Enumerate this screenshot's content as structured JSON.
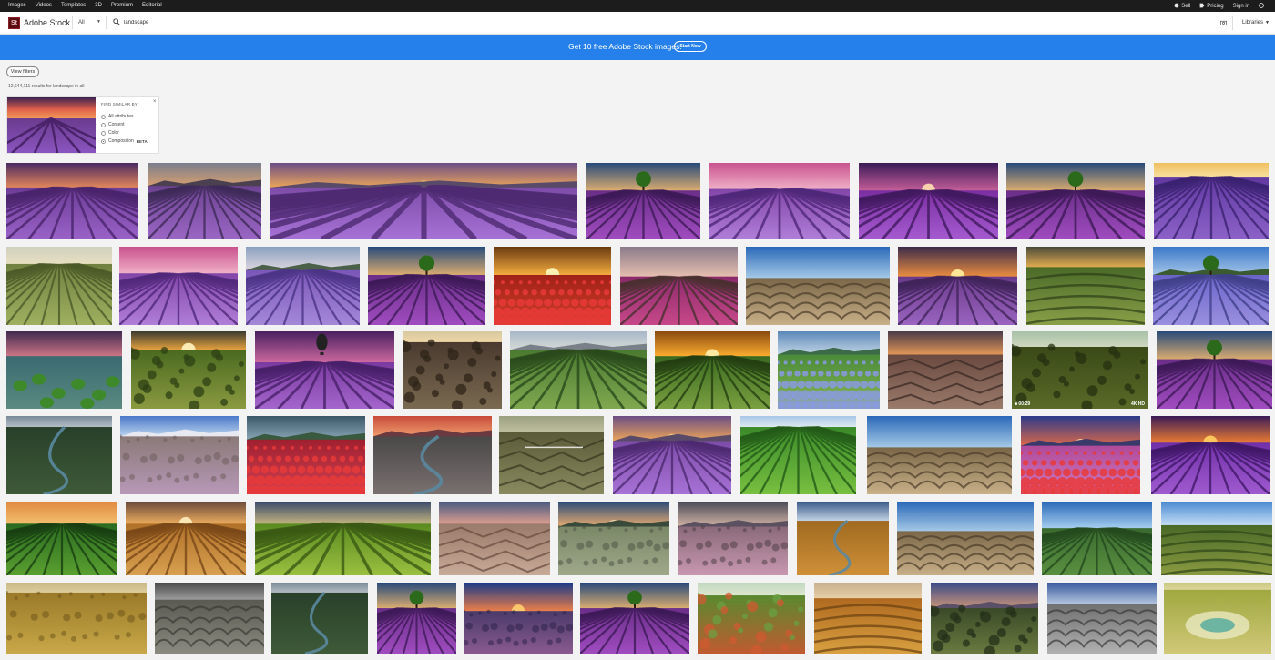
{
  "topnav": {
    "items": [
      "Images",
      "Videos",
      "Templates",
      "3D",
      "Premium",
      "Editorial"
    ],
    "sell": "Sell",
    "pricing": "Pricing",
    "signin": "Sign in"
  },
  "search": {
    "logo_mark": "St",
    "logo_text": "Adobe Stock",
    "category": "All",
    "query": "landscape",
    "libraries": "Libraries"
  },
  "banner": {
    "text": "Get 10 free Adobe Stock images.",
    "button": "Start Now"
  },
  "filters": {
    "view_label": "View filters",
    "results": "12,644,111 results for landscape in all"
  },
  "find_similar": {
    "title": "FIND SIMILAR BY:",
    "close": "×",
    "options": [
      {
        "label": "All attributes",
        "selected": false
      },
      {
        "label": "Content",
        "selected": false
      },
      {
        "label": "Color",
        "selected": false
      },
      {
        "label": "Composition",
        "selected": true,
        "tag": "BETA"
      }
    ]
  },
  "colors": {
    "topbar": "#1c1c1c",
    "banner": "#2680eb",
    "logo": "#5a0c12"
  },
  "tiles": [
    {
      "theme": "lavender-dusk"
    },
    {
      "theme": "lavender-hills"
    },
    {
      "theme": "lavender-sunset"
    },
    {
      "theme": "lavender-tree"
    },
    {
      "theme": "lavender-pink"
    },
    {
      "theme": "lavender-violet"
    },
    {
      "theme": "lavender-tree"
    },
    {
      "theme": "lavender-gold"
    },
    {
      "theme": "green-field"
    },
    {
      "theme": "lavender-pink"
    },
    {
      "theme": "lavender-mountain"
    },
    {
      "theme": "lavender-tree"
    },
    {
      "theme": "poppy-sunset"
    },
    {
      "theme": "tulip-path"
    },
    {
      "theme": "desert-dunes"
    },
    {
      "theme": "lavender-sunburst"
    },
    {
      "theme": "terraces"
    },
    {
      "theme": "lavender-village"
    },
    {
      "theme": "coast-moss"
    },
    {
      "theme": "moss-sunburst"
    },
    {
      "theme": "lavender-balloon"
    },
    {
      "theme": "aerial-bush"
    },
    {
      "theme": "vineyard"
    },
    {
      "theme": "field-sunrise"
    },
    {
      "theme": "hydrangea-field"
    },
    {
      "theme": "canyon-dusk"
    },
    {
      "theme": "aerial-forest",
      "badge_left": "00:29",
      "badge_right": "4K  HD"
    },
    {
      "theme": "lavender-tree"
    },
    {
      "theme": "forest-river"
    },
    {
      "theme": "rock-meadow"
    },
    {
      "theme": "red-moor"
    },
    {
      "theme": "river-dusk"
    },
    {
      "theme": "canyon-bridge"
    },
    {
      "theme": "lavender-sunset"
    },
    {
      "theme": "green-rows"
    },
    {
      "theme": "desert-dunes"
    },
    {
      "theme": "mountain-flowers"
    },
    {
      "theme": "lavender-fire"
    },
    {
      "theme": "green-rows-dusk"
    },
    {
      "theme": "wheat-sunset"
    },
    {
      "theme": "green-grass"
    },
    {
      "theme": "badlands"
    },
    {
      "theme": "mountain-rocks"
    },
    {
      "theme": "pink-meadow"
    },
    {
      "theme": "valley-river"
    },
    {
      "theme": "desert-dunes"
    },
    {
      "theme": "tea-hills"
    },
    {
      "theme": "green-hills"
    },
    {
      "theme": "savanna"
    },
    {
      "theme": "karst"
    },
    {
      "theme": "forest-river"
    },
    {
      "theme": "lavender-tree"
    },
    {
      "theme": "sunset-meadow"
    },
    {
      "theme": "lavender-tree"
    },
    {
      "theme": "kochia-field"
    },
    {
      "theme": "autumn-plain"
    },
    {
      "theme": "mountain-dusk"
    },
    {
      "theme": "mono-falls"
    },
    {
      "theme": "hot-spring"
    }
  ]
}
